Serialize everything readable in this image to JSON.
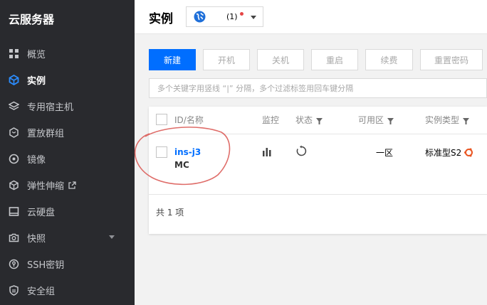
{
  "sidebar": {
    "brand": "云服务器",
    "items": [
      {
        "label": "概览",
        "icon": "grid-icon"
      },
      {
        "label": "实例",
        "icon": "cube-icon",
        "active": true
      },
      {
        "label": "专用宿主机",
        "icon": "layers-icon"
      },
      {
        "label": "置放群组",
        "icon": "hexagon-icon"
      },
      {
        "label": "镜像",
        "icon": "disc-icon"
      },
      {
        "label": "弹性伸缩",
        "icon": "box-icon",
        "external": true
      },
      {
        "label": "云硬盘",
        "icon": "disk-icon"
      },
      {
        "label": "快照",
        "icon": "camera-icon",
        "expandable": true
      },
      {
        "label": "SSH密钥",
        "icon": "key-icon"
      },
      {
        "label": "安全组",
        "icon": "shield-icon"
      }
    ]
  },
  "header": {
    "title": "实例",
    "region_count": "(1)"
  },
  "toolbar": {
    "new": "新建",
    "start": "开机",
    "shutdown": "关机",
    "restart": "重启",
    "renew": "续费",
    "reset_password": "重置密码"
  },
  "search": {
    "placeholder": "多个关键字用竖线 “|” 分隔，多个过滤标签用回车键分隔"
  },
  "table": {
    "columns": {
      "id_name": "ID/名称",
      "monitor": "监控",
      "status": "状态",
      "zone": "可用区",
      "type": "实例类型"
    },
    "rows": [
      {
        "id": "ins-j3",
        "name": "MC",
        "zone": "一区",
        "type": "标准型S2"
      }
    ],
    "footer": "共 1 项"
  },
  "colors": {
    "primary": "#006eff",
    "sidebar_bg": "#292a2e",
    "status_dot": "#e54545",
    "annotation": "#d9534f"
  }
}
